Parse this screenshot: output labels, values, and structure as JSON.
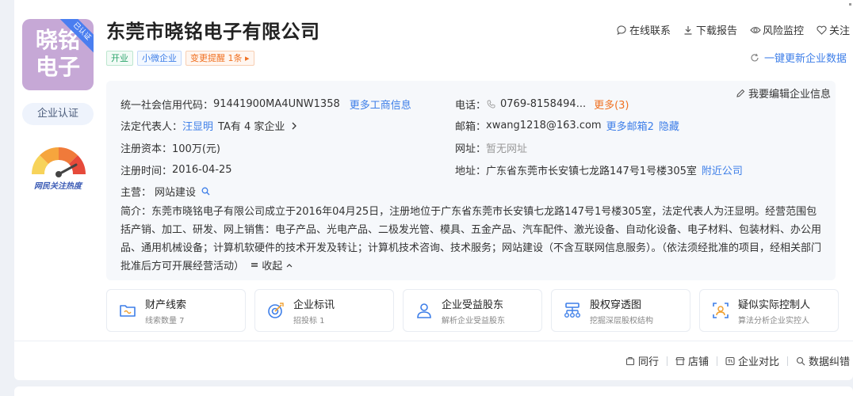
{
  "logo": {
    "text": "晓铭电子",
    "ribbon": "已认证"
  },
  "company": {
    "name": "东莞市晓铭电子有限公司",
    "tags": [
      "开业",
      "小微企业",
      "变更提醒 1条 ▸"
    ]
  },
  "actions": [
    {
      "icon": "chat-icon",
      "label": "在线联系"
    },
    {
      "icon": "download-icon",
      "label": "下载报告"
    },
    {
      "icon": "eye-icon",
      "label": "风险监控"
    },
    {
      "icon": "heart-icon",
      "label": "关注"
    }
  ],
  "update_label": "一键更新企业数据",
  "cert_label": "企业认证",
  "heat_label": "网民关注热度",
  "edit_label": "我要编辑企业信息",
  "info": {
    "credit_code_label": "统一社会信用代码：",
    "credit_code": "91441900MA4UNW1358",
    "more_business": "更多工商信息",
    "legal_rep_label": "法定代表人：",
    "legal_rep": "汪显明",
    "legal_rep_companies": "TA有 4 家企业",
    "capital_label": "注册资本：",
    "capital": "100万(元)",
    "reg_time_label": "注册时间：",
    "reg_time": "2016-04-25",
    "supervisor_label": "主营：",
    "supervisor": "网站建设",
    "phone_label": "电话：",
    "phone": "0769-8158494...",
    "phone_more": "更多(3)",
    "email_label": "邮箱：",
    "email": "xwang1218@163.com",
    "email_more": "更多邮箱2",
    "email_hide": "隐藏",
    "website_label": "网址：",
    "website": "暂无网址",
    "address_label": "地址：",
    "address": "广东省东莞市长安镇七龙路147号1号楼305室",
    "address_nearby": "附近公司",
    "summary": "简介：东莞市晓铭电子有限公司成立于2016年04月25日，注册地位于广东省东莞市长安镇七龙路147号1号楼305室，法定代表人为汪显明。经营范围包括产销、加工、研发、网上销售：电子产品、光电产品、二极发光管、模具、五金产品、汽车配件、激光设备、自动化设备、电子材料、包装材料、办公用品、通用机械设备；计算机软硬件的技术开发及转让；计算机技术咨询、技术服务；网站建设（不含互联网信息服务）。（依法须经批准的项目，经相关部门批准后方可开展经营活动）",
    "collapse": "收起"
  },
  "features": [
    {
      "icon": "folder-icon",
      "title": "财产线索",
      "sub": "线索数量 7",
      "color": "#3d7ee8"
    },
    {
      "icon": "target-icon",
      "title": "企业标讯",
      "sub": "招投标 1",
      "color": "#3d7ee8"
    },
    {
      "icon": "person-icon",
      "title": "企业受益股东",
      "sub": "解析企业受益股东",
      "color": "#3d7ee8"
    },
    {
      "icon": "org-chart-icon",
      "title": "股权穿透图",
      "sub": "挖掘深层股权结构",
      "color": "#3d7ee8"
    },
    {
      "icon": "controller-icon",
      "title": "疑似实际控制人",
      "sub": "算法分析企业实控人",
      "color": "#3d7ee8"
    }
  ],
  "footer": [
    {
      "icon": "peer-icon",
      "label": "同行"
    },
    {
      "icon": "store-icon",
      "label": "店铺"
    },
    {
      "icon": "compare-icon",
      "label": "企业对比"
    },
    {
      "icon": "correction-icon",
      "label": "数据纠错"
    }
  ]
}
